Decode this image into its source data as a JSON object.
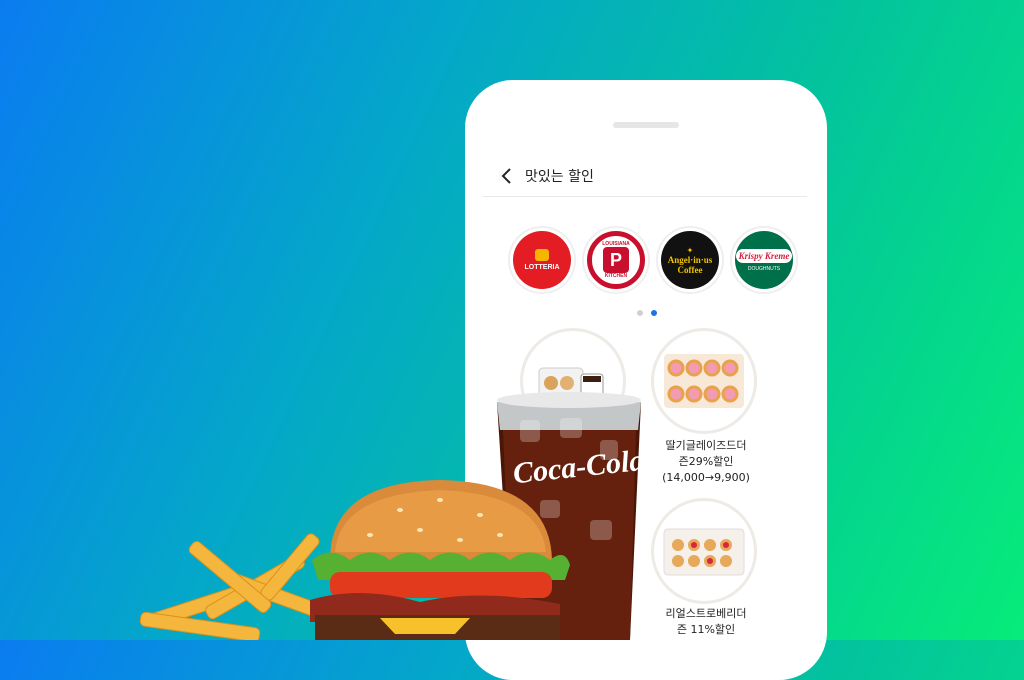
{
  "header": {
    "title": "맛있는 할인"
  },
  "brands": [
    {
      "name": "LOTTERIA",
      "color": "#e31d23"
    },
    {
      "name_line1": "LOUISIANA",
      "name_line2": "KITCHEN",
      "letter": "P",
      "color": "#c8102e"
    },
    {
      "name_line1": "Angel·in·us",
      "name_line2": "Coffee",
      "color": "#111111"
    },
    {
      "name": "Krispy Kreme",
      "sub": "DOUGHNUTS",
      "color": "#00704a"
    }
  ],
  "carousel": {
    "pages": 2,
    "active": 2
  },
  "products": [
    {
      "name": "딸기글레이즈드더",
      "line2": "즌29%할인",
      "line3": "(14,000→9,900)"
    },
    {
      "name": "리얼스트로베리더",
      "line2": "즌 11%할인"
    }
  ],
  "drink_brand": "Coca-Cola",
  "colors": {
    "accent": "#1a73e8",
    "gradient_start": "#0a7cf0",
    "gradient_end": "#06ec7a"
  }
}
